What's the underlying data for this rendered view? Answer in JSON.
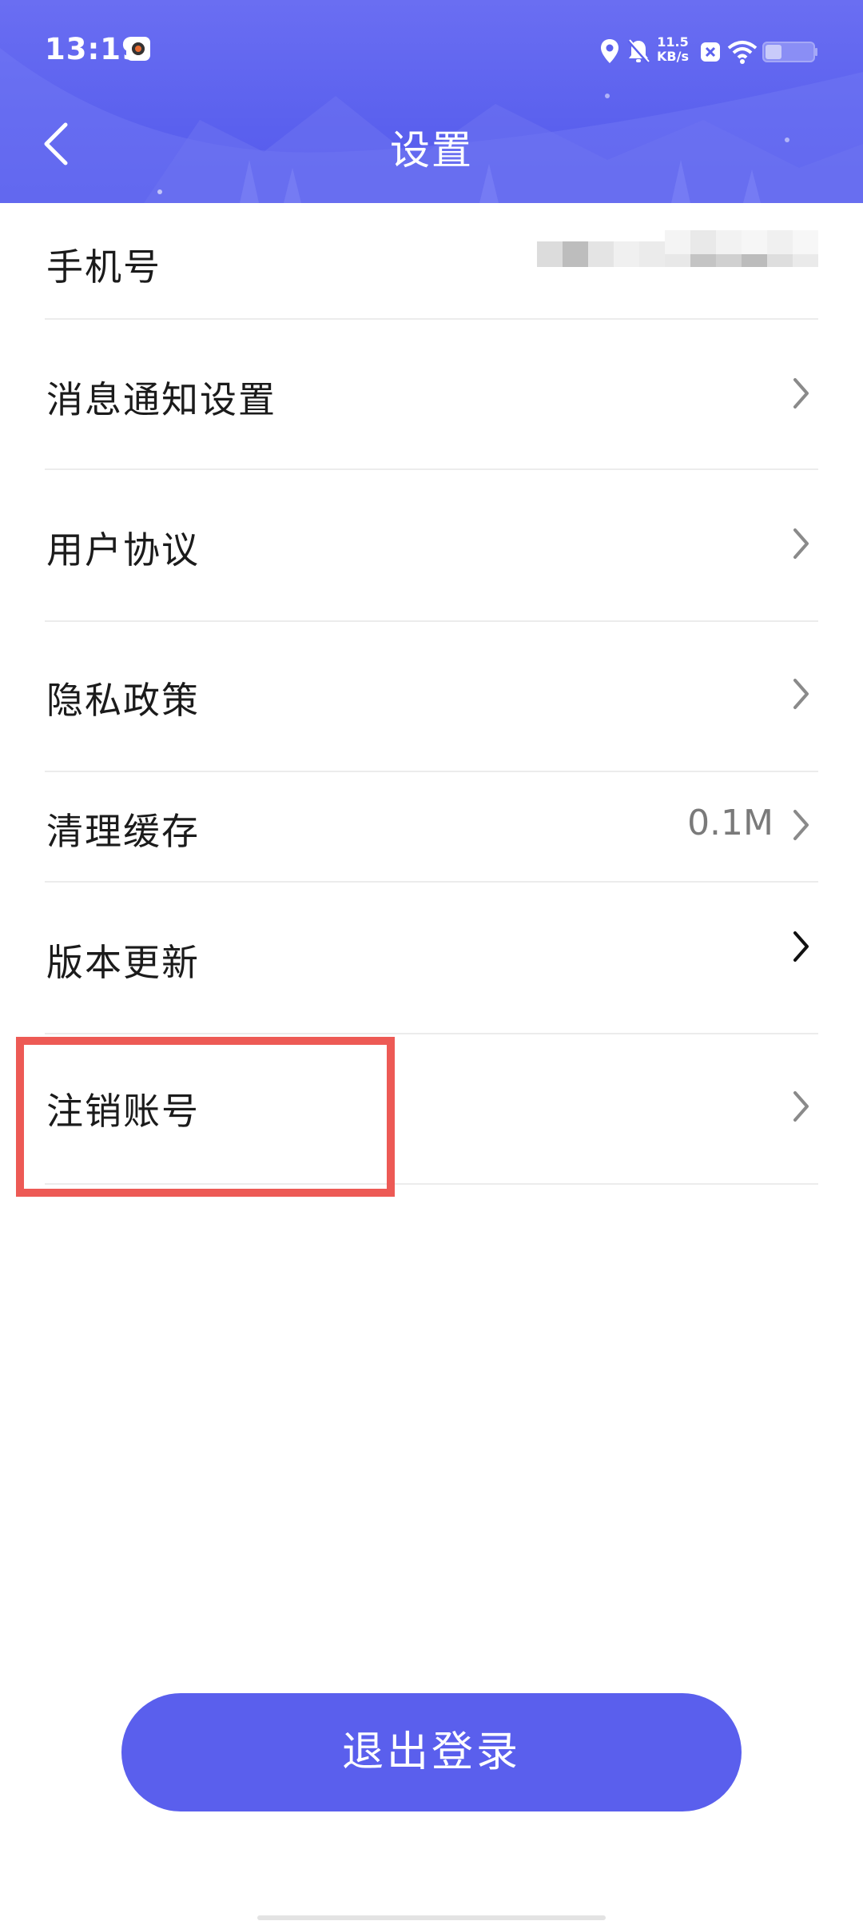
{
  "status_bar": {
    "time": "13:19",
    "net_speed_value": "11.5",
    "net_speed_unit": "KB/s"
  },
  "header": {
    "title": "设置"
  },
  "settings": {
    "phone": {
      "label": "手机号",
      "value": ""
    },
    "notifications": {
      "label": "消息通知设置"
    },
    "user_agreement": {
      "label": "用户协议"
    },
    "privacy_policy": {
      "label": "隐私政策"
    },
    "clear_cache": {
      "label": "清理缓存",
      "value": "0.1M"
    },
    "version_update": {
      "label": "版本更新"
    },
    "delete_account": {
      "label": "注销账号"
    }
  },
  "logout": {
    "label": "退出登录"
  },
  "colors": {
    "accent": "#5a5fed",
    "highlight": "#ed5a55"
  }
}
